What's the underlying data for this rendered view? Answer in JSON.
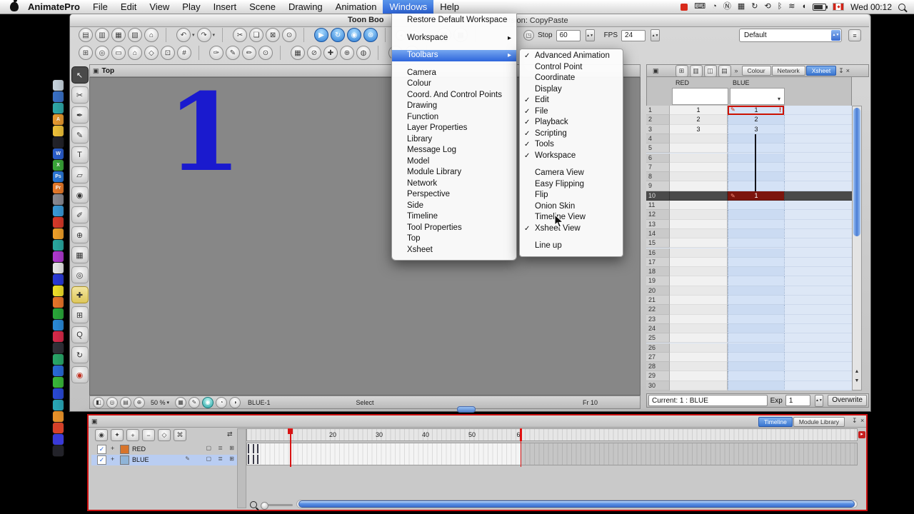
{
  "menubar": {
    "items": [
      "AnimatePro",
      "File",
      "Edit",
      "View",
      "Play",
      "Insert",
      "Scene",
      "Drawing",
      "Animation",
      "Windows",
      "Help"
    ],
    "active": "Windows",
    "status_icons": [
      "⌨",
      "◔",
      "Ⓝ",
      "▦",
      "↻",
      "⟲",
      "ᛒ",
      "≋",
      "◖"
    ],
    "clock": "Wed 00:12"
  },
  "titlebar": {
    "title": "Toon Boo",
    "version": "Version: CopyPaste"
  },
  "playback": {
    "stop_label": "Stop",
    "stop_value": "60",
    "fps_label": "FPS",
    "fps_value": "24"
  },
  "workspace_combo": {
    "value": "Default"
  },
  "toolbar_row1_groups": [
    {
      "icons": [
        "▤",
        "▥",
        "▦",
        "▧",
        "⌂"
      ]
    },
    {
      "icons": [
        "↶",
        "↷"
      ],
      "drop": true
    },
    {
      "icons": [
        "✂",
        "❏",
        "⊠",
        "⊙"
      ]
    },
    {
      "icons": [
        "▶",
        "↻",
        "◉",
        "⊛"
      ],
      "blue": true
    },
    {
      "icons": [
        "◂",
        "▸"
      ],
      "small": true
    },
    {
      "icons": [
        "▣",
        "▩"
      ]
    }
  ],
  "toolbar_row2_groups": [
    {
      "icons": [
        "⊞",
        "◎",
        "▭",
        "⌂",
        "◇",
        "⊡",
        "#"
      ]
    },
    {
      "icons": [
        "✑",
        "✎",
        "✏",
        "⊙"
      ]
    },
    {
      "icons": [
        "▦",
        "⊘",
        "✚",
        "⊕",
        "◍"
      ]
    },
    {
      "icons": [
        "❏",
        "▣"
      ]
    }
  ],
  "tools_left": [
    {
      "g": "↖",
      "name": "select-tool",
      "pressed": true
    },
    {
      "g": "✂",
      "name": "cutter-tool"
    },
    {
      "g": "✒",
      "name": "contour-editor-tool"
    },
    {
      "g": "✎",
      "name": "pencil-tool"
    },
    {
      "g": "T",
      "name": "text-tool"
    },
    {
      "g": "▱",
      "name": "eraser-tool"
    },
    {
      "g": "◉",
      "name": "paint-tool"
    },
    {
      "g": "✐",
      "name": "ink-tool"
    },
    {
      "g": "⊕",
      "name": "line-tool"
    },
    {
      "g": "▦",
      "name": "polyline-tool"
    },
    {
      "g": "◎",
      "name": "dropper-tool"
    },
    {
      "g": "✚",
      "name": "transform-tool",
      "active": true
    },
    {
      "g": "⊞",
      "name": "hand-tool"
    },
    {
      "g": "Q",
      "name": "zoom-tool"
    },
    {
      "g": "↻",
      "name": "rotate-view-tool"
    },
    {
      "g": "◉",
      "name": "model-tool",
      "red": true
    }
  ],
  "dock_icons": [
    {
      "c": "#c8d4de",
      "g": ""
    },
    {
      "c": "#3a72c8",
      "g": ""
    },
    {
      "c": "#2fa8a8",
      "g": ""
    },
    {
      "c": "#e89a30",
      "g": "A"
    },
    {
      "c": "#f0c23a",
      "g": ""
    },
    {
      "c": "#23232a",
      "g": ""
    },
    {
      "c": "#2a5fd0",
      "g": "W"
    },
    {
      "c": "#3aa83a",
      "g": "X"
    },
    {
      "c": "#2a78d8",
      "g": "Ps"
    },
    {
      "c": "#e87a2a",
      "g": "Pr"
    },
    {
      "c": "#8a8a92",
      "g": ""
    },
    {
      "c": "#3a9ad8",
      "g": ""
    },
    {
      "c": "#d83a2a",
      "g": ""
    },
    {
      "c": "#f0a02a",
      "g": ""
    },
    {
      "c": "#2aa8a0",
      "g": ""
    },
    {
      "c": "#b03ad0",
      "g": ""
    },
    {
      "c": "#e8e8e8",
      "g": ""
    },
    {
      "c": "#2a3ad8",
      "g": ""
    },
    {
      "c": "#f0e02a",
      "g": ""
    },
    {
      "c": "#e8762a",
      "g": ""
    },
    {
      "c": "#2aa83a",
      "g": ""
    },
    {
      "c": "#2a8ad8",
      "g": ""
    },
    {
      "c": "#d82a4a",
      "g": ""
    },
    {
      "c": "#32323a",
      "g": ""
    },
    {
      "c": "#2aa86a",
      "g": ""
    },
    {
      "c": "#2a6ad8",
      "g": ""
    },
    {
      "c": "#3ab83a",
      "g": ""
    },
    {
      "c": "#2a4ad8",
      "g": ""
    },
    {
      "c": "#2aa8b8",
      "g": ""
    },
    {
      "c": "#e8922a",
      "g": ""
    },
    {
      "c": "#d8422a",
      "g": ""
    },
    {
      "c": "#3a3ad8",
      "g": ""
    },
    {
      "c": "#23232a",
      "g": ""
    }
  ],
  "windows_menu": {
    "items": [
      {
        "label": "Restore Default Workspace"
      },
      {
        "type": "spacer"
      },
      {
        "label": "Workspace",
        "submenu": true
      },
      {
        "type": "spacer"
      },
      {
        "label": "Toolbars",
        "submenu": true,
        "highlighted": true
      },
      {
        "type": "spacer"
      },
      {
        "label": "Camera"
      },
      {
        "label": "Colour"
      },
      {
        "label": "Coord. And Control Points"
      },
      {
        "label": "Drawing"
      },
      {
        "label": "Function"
      },
      {
        "label": "Layer Properties"
      },
      {
        "label": "Library"
      },
      {
        "label": "Message Log"
      },
      {
        "label": "Model"
      },
      {
        "label": "Module Library"
      },
      {
        "label": "Network"
      },
      {
        "label": "Perspective"
      },
      {
        "label": "Side"
      },
      {
        "label": "Timeline"
      },
      {
        "label": "Tool Properties"
      },
      {
        "label": "Top"
      },
      {
        "label": "Xsheet"
      }
    ]
  },
  "toolbars_submenu": {
    "items": [
      {
        "label": "Advanced Animation",
        "checked": true
      },
      {
        "label": "Control Point"
      },
      {
        "label": "Coordinate"
      },
      {
        "label": "Display"
      },
      {
        "label": "Edit",
        "checked": true
      },
      {
        "label": "File",
        "checked": true
      },
      {
        "label": "Playback",
        "checked": true
      },
      {
        "label": "Scripting",
        "checked": true
      },
      {
        "label": "Tools",
        "checked": true
      },
      {
        "label": "Workspace",
        "checked": true
      },
      {
        "type": "spacer"
      },
      {
        "label": "Camera View"
      },
      {
        "label": "Easy Flipping"
      },
      {
        "label": "Flip"
      },
      {
        "label": "Onion Skin"
      },
      {
        "label": "Timeline View"
      },
      {
        "label": "Xsheet View",
        "checked": true
      },
      {
        "type": "spacer"
      },
      {
        "label": "Line up"
      }
    ]
  },
  "canvas": {
    "view_label": "Top",
    "drawing_number": "1",
    "status_icons_a": [
      "◧",
      "◎",
      "▤",
      "⊕"
    ],
    "zoom": "50 %",
    "status_icons_b": [
      "▦",
      "✎"
    ],
    "status_icon_active": "◉",
    "status_icons_c": [
      "◔",
      "◑"
    ],
    "layer_badge": "BLUE-1",
    "tool_status": "Select",
    "frame_status": "Fr 10"
  },
  "xsheet": {
    "toolbar_icons": [
      "⊞",
      "▥",
      "◫",
      "▤"
    ],
    "tabs": [
      "Colour",
      "Network",
      "Xsheet"
    ],
    "active_tab": "Xsheet",
    "columns": [
      "RED",
      "BLUE"
    ],
    "row_count": 30,
    "red_values": [
      "1",
      "2",
      "3"
    ],
    "blue_values": [
      "1",
      "2",
      "3"
    ],
    "selected_cell": {
      "row": 1,
      "column": "BLUE",
      "value": "1"
    },
    "marker_row": {
      "row": 10,
      "column": "BLUE",
      "value": "1"
    },
    "current_label": "Current: 1 : BLUE",
    "exp_label": "Exp",
    "exp_value": "1",
    "overwrite_label": "Overwrite"
  },
  "timeline": {
    "tabs": [
      "Timeline",
      "Module Library"
    ],
    "active_tab": "Timeline",
    "toolbar_icons": [
      "◉",
      "✦",
      "+",
      "−",
      "◇",
      "⌘"
    ],
    "layers": [
      {
        "name": "RED",
        "checked": true,
        "selected": false
      },
      {
        "name": "BLUE",
        "checked": true,
        "selected": true
      }
    ],
    "ruler_labels": [
      {
        "t": "20",
        "f": 20
      },
      {
        "t": "30",
        "f": 30
      },
      {
        "t": "40",
        "f": 40
      },
      {
        "t": "50",
        "f": 50
      },
      {
        "t": "6",
        "f": 60
      }
    ],
    "playhead_frame": 10,
    "stop_frame": 60
  },
  "colors": {
    "accent": "#3b78dd",
    "marker_red": "#7c150d",
    "timeline_border": "#cc1111",
    "ink_blue": "#1a1ace"
  }
}
